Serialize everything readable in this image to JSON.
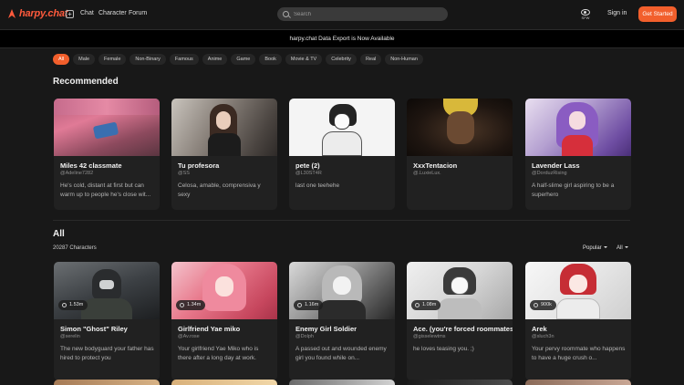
{
  "nav": {
    "logo": "harpy.chat",
    "links": [
      "Chat",
      "Character",
      "Forum"
    ],
    "search_placeholder": "Search",
    "sfw_label": "SFW",
    "signin": "Sign in",
    "get_started": "Get Started"
  },
  "banner": "harpy.chat Data Export is Now Available",
  "filters": [
    "All",
    "Male",
    "Female",
    "Non-Binary",
    "Famous",
    "Anime",
    "Game",
    "Book",
    "Movie & TV",
    "Celebrity",
    "Real",
    "Non-Human"
  ],
  "recommended": {
    "title": "Recommended",
    "cards": [
      {
        "name": "Miles 42 classmate",
        "handle": "@Adeline7282",
        "desc": "He's cold, distant at first but can warm up to people he's close wit..."
      },
      {
        "name": "Tu profesora",
        "handle": "@SS",
        "desc": "Celosa, amable, comprensiva y sexy"
      },
      {
        "name": "pete (2)",
        "handle": "@L30ST4R",
        "desc": "last one teehehe"
      },
      {
        "name": "XxxTentacion",
        "handle": "@.LuxieLux.",
        "desc": ""
      },
      {
        "name": "Lavender Lass",
        "handle": "@DorduzRising",
        "desc": "A half-slime girl aspiring to be a superhero"
      }
    ]
  },
  "all": {
    "title": "All",
    "count": "20287 Characters",
    "sort": "Popular",
    "filter": "All",
    "cards": [
      {
        "name": "Simon \"Ghost\" Riley",
        "handle": "@serelin",
        "desc": "The new bodyguard your father has hired to protect you",
        "chats": "1.53m"
      },
      {
        "name": "Girlfriend Yae miko",
        "handle": "@Av.rose",
        "desc": "Your girlfriend Yae Miko who is there after a long day at work.",
        "chats": "1.34m"
      },
      {
        "name": "Enemy Girl Soldier",
        "handle": "@Dolph",
        "desc": "A passed out and wounded enemy girl you found while on...",
        "chats": "1.16m"
      },
      {
        "name": "Ace. (you're forced roommates)",
        "handle": "@gisselewtms",
        "desc": "he loves teasing you. ;)",
        "chats": "1.08m"
      },
      {
        "name": "Arek",
        "handle": "@sluch3n",
        "desc": "Your pervy roommate who happens to have a huge crush o...",
        "chats": "900k"
      }
    ]
  }
}
